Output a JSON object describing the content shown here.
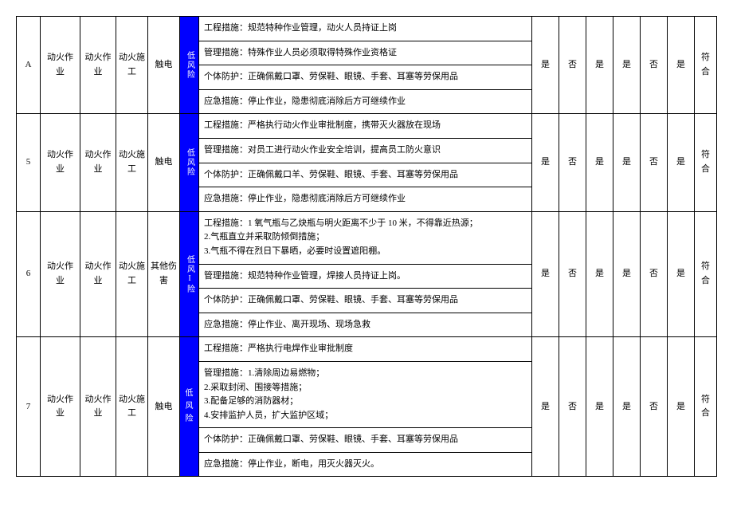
{
  "rows": [
    {
      "idx": "A",
      "c1": "动火作业",
      "c2": "动火作业",
      "c3": "动火施工",
      "c4": "触电",
      "risk": "低风险",
      "riskLayout": "v",
      "measures": [
        "工程措施：规范特种作业管理，动火人员持证上岗",
        "管理措施：特殊作业人员必须取得特殊作业资格证",
        "个体防护：正确佩戴口罩、劳保鞋、眼镜、手套、耳塞等劳保用品",
        "应急措施：停止作业，隐患彻底消除后方可继续作业"
      ],
      "yn": [
        "是",
        "否",
        "是",
        "是",
        "否",
        "是"
      ],
      "res": "符合"
    },
    {
      "idx": "5",
      "c1": "动火作业",
      "c2": "动火作业",
      "c3": "动火施工",
      "c4": "触电",
      "risk": "低风险",
      "riskLayout": "v",
      "measures": [
        "工程措施：严格执行动火作业审批制度，携带灭火器放在现场",
        "管理措施：对员工进行动火作业安全培训，提高员工防火意识",
        "个体防护：正确佩戴口羊、劳保鞋、眼镜、手套、耳塞等劳保用品",
        "应急措施：停止作业，隐患彻底消除后方可继续作业"
      ],
      "yn": [
        "是",
        "否",
        "是",
        "是",
        "否",
        "是"
      ],
      "res": "符合"
    },
    {
      "idx": "6",
      "c1": "动火作业",
      "c2": "动火作业",
      "c3": "动火施工",
      "c4": "其他伤害",
      "risk": "低风I险",
      "riskLayout": "v",
      "measures": [
        "工程措施：1 氧气瓶与乙炔瓶与明火距离不少于 10 米，不得靠近热源；\n2.气瓶直立并采取防倾倒措施；\n3.气瓶不得在烈日下暴晒，必要时设置遮阳棚。",
        "管理措施：规范特种作业管理，焊接人员持证上岗。",
        "个体防护：正确佩戴口罩、劳保鞋、眼镜、手套、耳塞等劳保用品",
        "应急措施：停止作业、离开现场、现场急救"
      ],
      "yn": [
        "是",
        "否",
        "是",
        "是",
        "否",
        "是"
      ],
      "res": "符合"
    },
    {
      "idx": "7",
      "c1": "动火作业",
      "c2": "动火作业",
      "c3": "动火施工",
      "c4": "触电",
      "risk": "低风险",
      "riskLayout": "h",
      "measures": [
        "工程措施：严格执行电焊作业审批制度",
        "管理措施：1.清除周边易燃物；\n2.采取封闭、围接等措施；\n3.配备足够的消防器材；\n4.安排监护人员，扩大监护区域；",
        "个体防护：正确佩戴口罩、劳保鞋、眼镜、手套、耳塞等劳保用品",
        "应急措施：停止作业，断电，用灭火器灭火。"
      ],
      "yn": [
        "是",
        "否",
        "是",
        "是",
        "否",
        "是"
      ],
      "res": "符合"
    }
  ]
}
